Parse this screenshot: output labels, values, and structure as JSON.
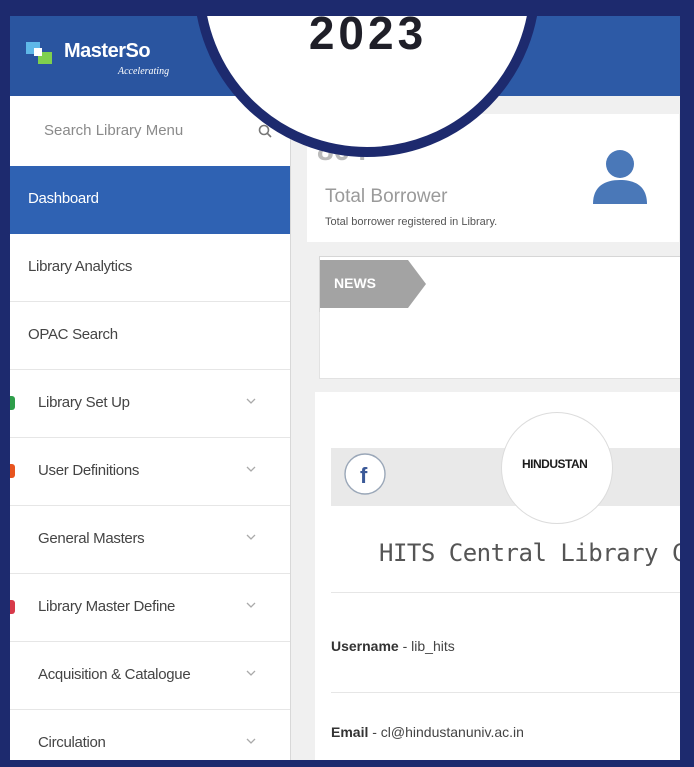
{
  "year_badge": "2023",
  "brand": {
    "name": "MasterSo",
    "tagline": "Accelerating"
  },
  "sidebar": {
    "search_placeholder": "Search Library Menu",
    "items": [
      {
        "label": "Dashboard",
        "active": true
      },
      {
        "label": "Library Analytics"
      },
      {
        "label": "OPAC Search"
      },
      {
        "label": "Library Set Up",
        "expandable": true,
        "bullet_color": "#2e9e4a"
      },
      {
        "label": "User Definitions",
        "expandable": true,
        "bullet_color": "#e8541f"
      },
      {
        "label": "General Masters",
        "expandable": true
      },
      {
        "label": "Library Master Define",
        "expandable": true,
        "bullet_color": "#d83a4a"
      },
      {
        "label": "Acquisition & Catalogue",
        "expandable": true
      },
      {
        "label": "Circulation",
        "expandable": true
      }
    ]
  },
  "stats": {
    "count": "804",
    "title": "Total Borrower",
    "subtitle": "Total borrower registered in Library."
  },
  "news": {
    "label": "NEWS"
  },
  "profile": {
    "logo_text": "HINDUSTAN",
    "institution": "HITS Central Library Che",
    "username_label": "Username",
    "username_value": " - lib_hits",
    "email_label": "Email",
    "email_value": " - cl@hindustanuniv.ac.in"
  },
  "colors": {
    "accent": "#2f62b3",
    "header": "#2d5aa6",
    "frame": "#1d2a6e"
  }
}
